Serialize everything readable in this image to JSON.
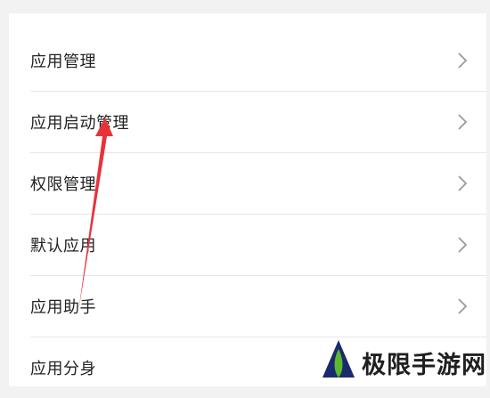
{
  "menu": {
    "items": [
      {
        "label": "应用管理",
        "has_chevron": true
      },
      {
        "label": "应用启动管理",
        "has_chevron": true
      },
      {
        "label": "权限管理",
        "has_chevron": true
      },
      {
        "label": "默认应用",
        "has_chevron": true
      },
      {
        "label": "应用助手",
        "has_chevron": true
      },
      {
        "label": "应用分身",
        "has_chevron": false
      }
    ]
  },
  "annotation": {
    "type": "arrow",
    "color": "#e8323a",
    "points_to": "应用启动管理"
  },
  "watermark": {
    "text": "极限手游网",
    "logo_colors": [
      "#1a2a6c",
      "#5cb82e"
    ]
  },
  "icons": {
    "chevron": "chevron-right-icon"
  }
}
